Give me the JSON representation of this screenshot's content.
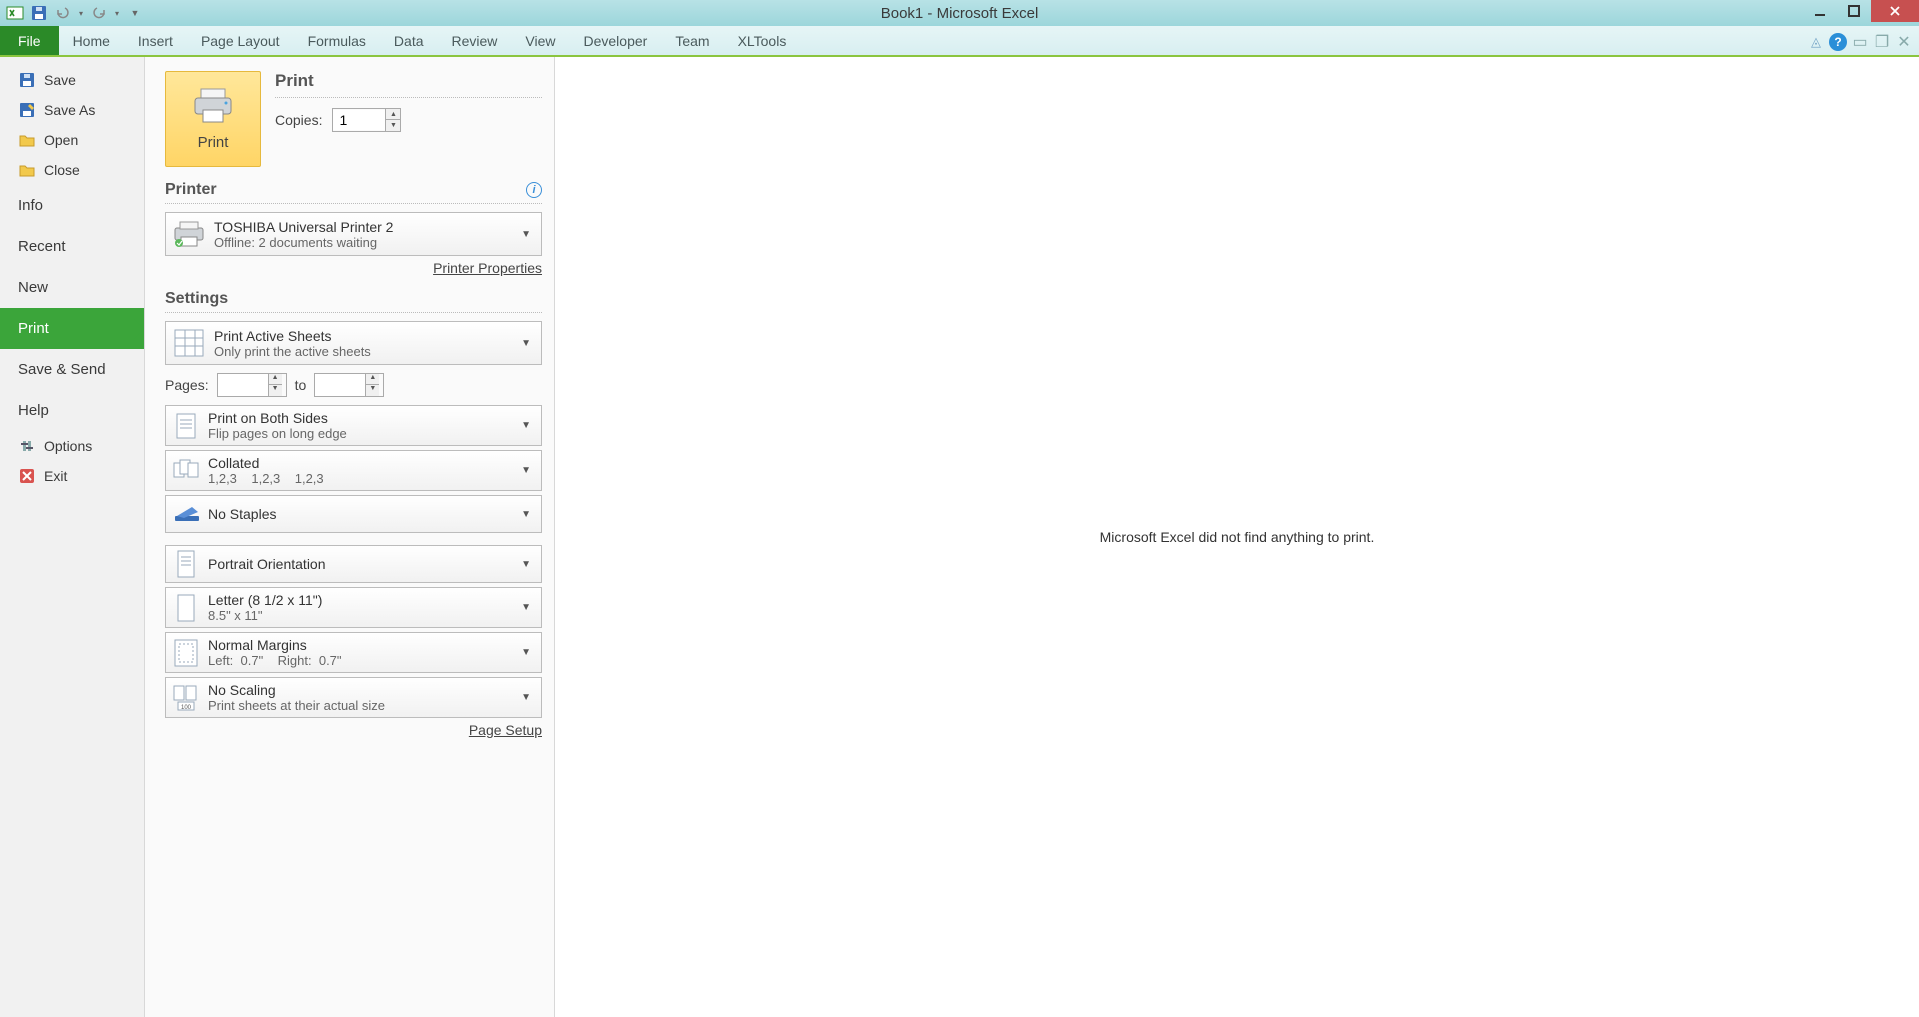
{
  "title": "Book1 - Microsoft Excel",
  "ribbon": {
    "file": "File",
    "tabs": [
      "Home",
      "Insert",
      "Page Layout",
      "Formulas",
      "Data",
      "Review",
      "View",
      "Developer",
      "Team",
      "XLTools"
    ]
  },
  "sidebar": {
    "save": "Save",
    "save_as": "Save As",
    "open": "Open",
    "close": "Close",
    "info": "Info",
    "recent": "Recent",
    "new": "New",
    "print": "Print",
    "save_send": "Save & Send",
    "help": "Help",
    "options": "Options",
    "exit": "Exit"
  },
  "print": {
    "heading": "Print",
    "button_label": "Print",
    "copies_label": "Copies:",
    "copies_value": "1",
    "printer_heading": "Printer",
    "printer": {
      "name": "TOSHIBA Universal Printer 2",
      "status": "Offline: 2 documents waiting"
    },
    "printer_properties": "Printer Properties",
    "settings_heading": "Settings",
    "active_sheets": {
      "title": "Print Active Sheets",
      "sub": "Only print the active sheets"
    },
    "pages_label": "Pages:",
    "pages_to": "to",
    "duplex": {
      "title": "Print on Both Sides",
      "sub": "Flip pages on long edge"
    },
    "collate": {
      "title": "Collated",
      "sub": "1,2,3    1,2,3    1,2,3"
    },
    "staples": {
      "title": "No Staples"
    },
    "orientation": {
      "title": "Portrait Orientation"
    },
    "paper": {
      "title": "Letter (8 1/2 x 11\")",
      "sub": "8.5\" x 11\""
    },
    "margins": {
      "title": "Normal Margins",
      "sub": "Left:  0.7\"    Right:  0.7\""
    },
    "scaling": {
      "title": "No Scaling",
      "sub": "Print sheets at their actual size"
    },
    "page_setup": "Page Setup"
  },
  "preview": {
    "message": "Microsoft Excel did not find anything to print."
  }
}
